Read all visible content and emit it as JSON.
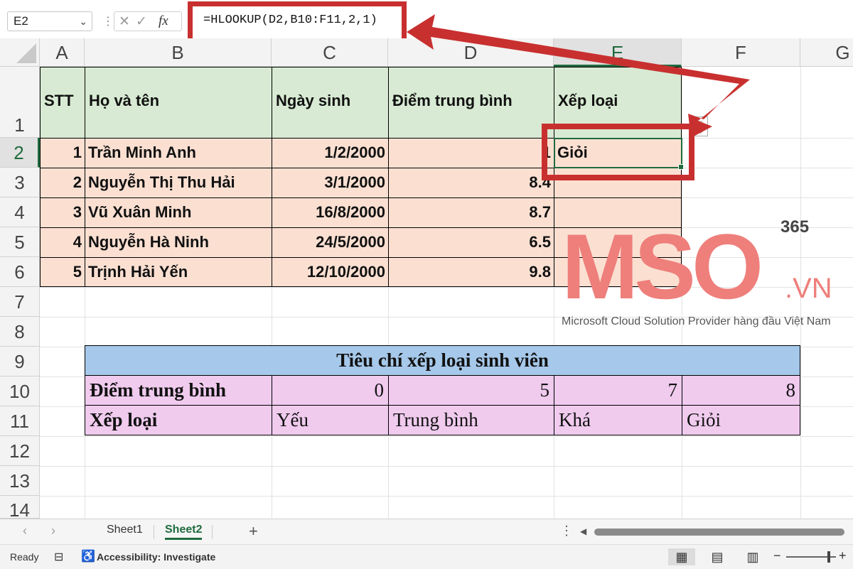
{
  "formula_bar": {
    "name_box": "E2",
    "name_box_arrow": "⌄",
    "separator": "⋮",
    "cancel_icon": "✕",
    "enter_icon": "✓",
    "fx_icon": "fx",
    "formula": "=HLOOKUP(D2,B10:F11,2,1)"
  },
  "columns": [
    "A",
    "B",
    "C",
    "D",
    "E",
    "F",
    "G"
  ],
  "rows": [
    "1",
    "2",
    "3",
    "4",
    "5",
    "6",
    "7",
    "8",
    "9",
    "10",
    "11",
    "12",
    "13",
    "14"
  ],
  "selected_column": "E",
  "selected_row": "2",
  "student_table": {
    "headers": [
      "STT",
      "Họ và tên",
      "Ngày sinh",
      "Điểm trung bình",
      "Xếp loại"
    ],
    "rows": [
      [
        "1",
        "Trần Minh Anh",
        "1/2/2000",
        "1",
        "Giỏi"
      ],
      [
        "2",
        "Nguyễn Thị Thu Hải",
        "3/1/2000",
        "8.4",
        ""
      ],
      [
        "3",
        "Vũ Xuân Minh",
        "16/8/2000",
        "8.7",
        ""
      ],
      [
        "4",
        "Nguyễn Hà Ninh",
        "24/5/2000",
        "6.5",
        ""
      ],
      [
        "5",
        "Trịnh Hải Yến",
        "12/10/2000",
        "9.8",
        ""
      ]
    ]
  },
  "criteria_table": {
    "title": "Tiêu chí xếp loại sinh viên",
    "row1": [
      "Điểm trung bình",
      "0",
      "5",
      "7",
      "8"
    ],
    "row2": [
      "Xếp loại",
      "Yếu",
      "Trung bình",
      "Khá",
      "Giỏi"
    ]
  },
  "watermark": {
    "logo": "MSO",
    "superscript": "365",
    "suffix": ".VN",
    "tagline": "Microsoft Cloud Solution Provider hàng đầu Việt Nam"
  },
  "sheet_tabs": {
    "prev": "‹",
    "next": "›",
    "tabs": [
      "Sheet1",
      "Sheet2"
    ],
    "active": "Sheet2",
    "add": "+",
    "more": "⋮",
    "scroll_left": "◀"
  },
  "status_bar": {
    "ready": "Ready",
    "accessibility": "Accessibility: Investigate",
    "zoom_minus": "−",
    "zoom_plus": "+"
  },
  "annotation_color": "#c8302f",
  "accent_color": "#1f6b3e"
}
